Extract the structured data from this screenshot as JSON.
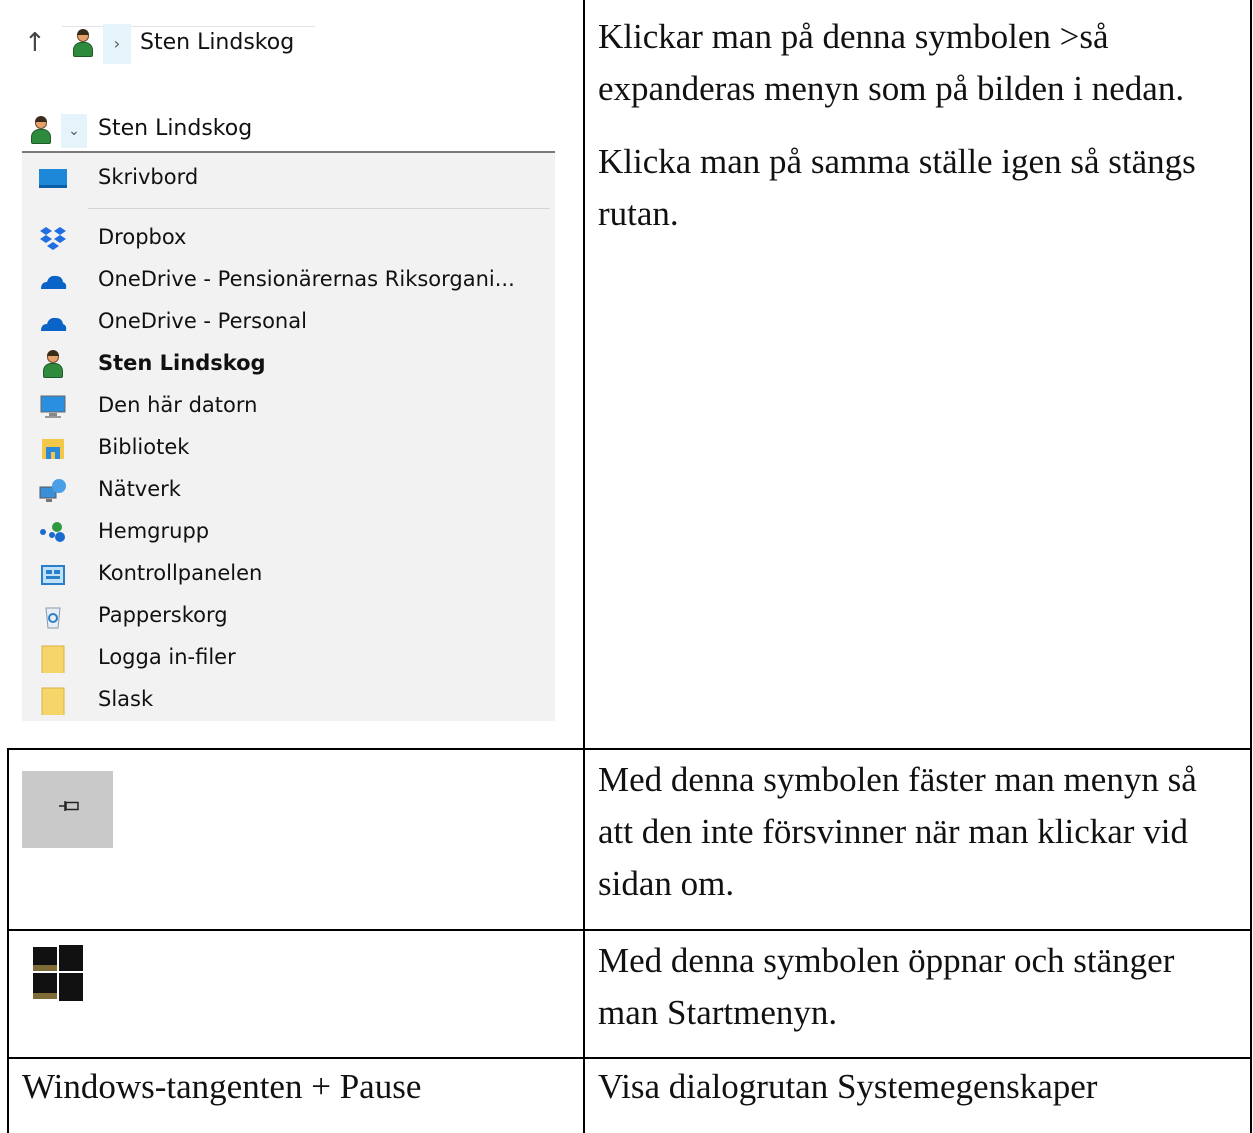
{
  "address_bar": {
    "up_icon": "up-arrow-icon",
    "user_icon": "person-icon",
    "chevron": "›",
    "path_label": "Sten Lindskog"
  },
  "menu": {
    "header_chevron": "⌄",
    "header_label": "Sten Lindskog",
    "items": [
      {
        "label": "Skrivbord",
        "icon": "desktop-icon"
      },
      {
        "label": "Dropbox",
        "icon": "dropbox-icon"
      },
      {
        "label": "OneDrive - Pensionärernas Riksorgani...",
        "icon": "onedrive-icon"
      },
      {
        "label": "OneDrive - Personal",
        "icon": "onedrive-icon"
      },
      {
        "label": "Sten Lindskog",
        "icon": "person-icon",
        "bold": true
      },
      {
        "label": "Den här datorn",
        "icon": "computer-icon"
      },
      {
        "label": "Bibliotek",
        "icon": "library-icon"
      },
      {
        "label": "Nätverk",
        "icon": "network-icon"
      },
      {
        "label": "Hemgrupp",
        "icon": "homegroup-icon"
      },
      {
        "label": "Kontrollpanelen",
        "icon": "control-panel-icon"
      },
      {
        "label": "Papperskorg",
        "icon": "recycle-bin-icon"
      },
      {
        "label": "Logga in-filer",
        "icon": "folder-icon"
      },
      {
        "label": "Slask",
        "icon": "folder-icon"
      }
    ]
  },
  "rows": [
    {
      "text": "Klickar man på denna symbolen >så\nexpanderas menyn som på bilden i nedan."
    },
    {
      "text": "Klicka man på samma ställe igen så stängs\nrutan."
    },
    {
      "text": "Med denna symbolen fäster man menyn så\natt den inte försvinner när man klickar vid\nsidan om."
    },
    {
      "text": "Med denna symbolen öppnar och stänger\nman Startmenyn."
    },
    {
      "left": "Windows-tangenten + Pause",
      "text": "Visa dialogrutan Systemegenskaper"
    }
  ],
  "icons": {
    "pin": "pin-icon",
    "start": "windows-start-icon"
  }
}
